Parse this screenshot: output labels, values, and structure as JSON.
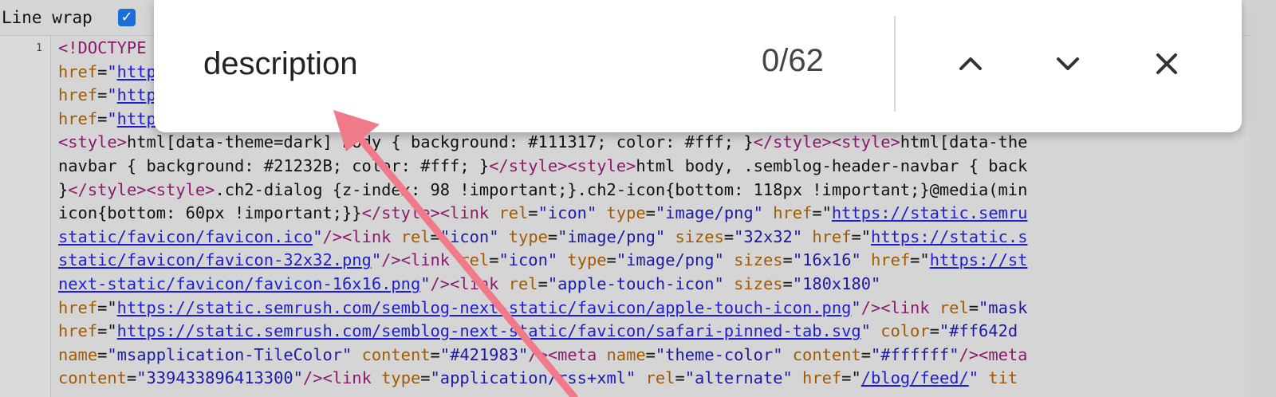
{
  "toolbar": {
    "line_wrap_label": "Line wrap",
    "line_wrap_checked": true
  },
  "gutter": {
    "line_number": "1"
  },
  "find_bar": {
    "query": "description",
    "count": "0/62",
    "prev_icon": "chevron-up-icon",
    "next_icon": "chevron-down-icon",
    "close_icon": "close-icon"
  },
  "colors": {
    "checkbox": "#1a6ed8",
    "annotation_arrow": "#f07a8a",
    "tag": "#8b1a6e",
    "attr": "#a05a00",
    "link": "#1e1ecf"
  },
  "source_lines": [
    [
      [
        "t",
        "<!DOCTYPE html>"
      ]
    ],
    [
      [
        "a",
        "href"
      ],
      [
        "k",
        "="
      ],
      [
        "v",
        "\""
      ],
      [
        "u",
        "https://static.semrush.com/"
      ],
      [
        "v",
        "\""
      ]
    ],
    [
      [
        "a",
        "href"
      ],
      [
        "k",
        "="
      ],
      [
        "v",
        "\""
      ],
      [
        "u",
        "https://static.semrush.com/"
      ],
      [
        "v",
        "\""
      ]
    ],
    [
      [
        "a",
        "href"
      ],
      [
        "k",
        "="
      ],
      [
        "v",
        "\""
      ],
      [
        "u",
        "https://static.semrush.com/"
      ],
      [
        "v",
        "\""
      ]
    ],
    [
      [
        "t",
        "<style>"
      ],
      [
        "k",
        "html[data-theme=dark] body { background: #111317; color: #fff; }"
      ],
      [
        "t",
        "</style><style>"
      ],
      [
        "k",
        "html[data-the"
      ]
    ],
    [
      [
        "k",
        "navbar { background: #21232B; color: #fff; }"
      ],
      [
        "t",
        "</style><style>"
      ],
      [
        "k",
        "html body, .semblog-header-navbar { back"
      ]
    ],
    [
      [
        "k",
        "}"
      ],
      [
        "t",
        "</style><style>"
      ],
      [
        "k",
        ".ch2-dialog {z-index: 98 !important;}.ch2-icon{bottom: 118px !important;}@media(min"
      ]
    ],
    [
      [
        "k",
        "icon{bottom: 60px !important;}}"
      ],
      [
        "t",
        "</style><link "
      ],
      [
        "a",
        "rel"
      ],
      [
        "k",
        "="
      ],
      [
        "v",
        "\"icon\""
      ],
      [
        "a",
        " type"
      ],
      [
        "k",
        "="
      ],
      [
        "v",
        "\"image/png\""
      ],
      [
        "a",
        " href"
      ],
      [
        "k",
        "=\""
      ],
      [
        "u",
        "https://static.semru"
      ]
    ],
    [
      [
        "u",
        "static/favicon/favicon.ico"
      ],
      [
        "v",
        "\""
      ],
      [
        "t",
        "/><link "
      ],
      [
        "a",
        "rel"
      ],
      [
        "k",
        "="
      ],
      [
        "v",
        "\"icon\""
      ],
      [
        "a",
        " type"
      ],
      [
        "k",
        "="
      ],
      [
        "v",
        "\"image/png\""
      ],
      [
        "a",
        " sizes"
      ],
      [
        "k",
        "="
      ],
      [
        "v",
        "\"32x32\""
      ],
      [
        "a",
        " href"
      ],
      [
        "k",
        "=\""
      ],
      [
        "u",
        "https://static.s"
      ]
    ],
    [
      [
        "u",
        "static/favicon/favicon-32x32.png"
      ],
      [
        "v",
        "\""
      ],
      [
        "t",
        "/><link "
      ],
      [
        "a",
        "rel"
      ],
      [
        "k",
        "="
      ],
      [
        "v",
        "\"icon\""
      ],
      [
        "a",
        " type"
      ],
      [
        "k",
        "="
      ],
      [
        "v",
        "\"image/png\""
      ],
      [
        "a",
        " sizes"
      ],
      [
        "k",
        "="
      ],
      [
        "v",
        "\"16x16\""
      ],
      [
        "a",
        " href"
      ],
      [
        "k",
        "=\""
      ],
      [
        "u",
        "https://st"
      ]
    ],
    [
      [
        "u",
        "next-static/favicon/favicon-16x16.png"
      ],
      [
        "v",
        "\""
      ],
      [
        "t",
        "/><link "
      ],
      [
        "a",
        "rel"
      ],
      [
        "k",
        "="
      ],
      [
        "v",
        "\"apple-touch-icon\""
      ],
      [
        "a",
        " sizes"
      ],
      [
        "k",
        "="
      ],
      [
        "v",
        "\"180x180\""
      ]
    ],
    [
      [
        "a",
        "href"
      ],
      [
        "k",
        "=\""
      ],
      [
        "u",
        "https://static.semrush.com/semblog-next-static/favicon/apple-touch-icon.png"
      ],
      [
        "v",
        "\""
      ],
      [
        "t",
        "/><link "
      ],
      [
        "a",
        "rel"
      ],
      [
        "k",
        "="
      ],
      [
        "v",
        "\"mask"
      ]
    ],
    [
      [
        "a",
        "href"
      ],
      [
        "k",
        "=\""
      ],
      [
        "u",
        "https://static.semrush.com/semblog-next-static/favicon/safari-pinned-tab.svg"
      ],
      [
        "v",
        "\""
      ],
      [
        "a",
        " color"
      ],
      [
        "k",
        "="
      ],
      [
        "v",
        "\"#ff642d"
      ]
    ],
    [
      [
        "a",
        "name"
      ],
      [
        "k",
        "="
      ],
      [
        "v",
        "\"msapplication-TileColor\""
      ],
      [
        "a",
        " content"
      ],
      [
        "k",
        "="
      ],
      [
        "v",
        "\"#421983\""
      ],
      [
        "t",
        "/><meta "
      ],
      [
        "a",
        "name"
      ],
      [
        "k",
        "="
      ],
      [
        "v",
        "\"theme-color\""
      ],
      [
        "a",
        " content"
      ],
      [
        "k",
        "="
      ],
      [
        "v",
        "\"#ffffff\""
      ],
      [
        "t",
        "/><meta"
      ]
    ],
    [
      [
        "a",
        "content"
      ],
      [
        "k",
        "="
      ],
      [
        "v",
        "\"339433896413300\""
      ],
      [
        "t",
        "/><link "
      ],
      [
        "a",
        "type"
      ],
      [
        "k",
        "="
      ],
      [
        "v",
        "\"application/rss+xml\""
      ],
      [
        "a",
        " rel"
      ],
      [
        "k",
        "="
      ],
      [
        "v",
        "\"alternate\""
      ],
      [
        "a",
        " href"
      ],
      [
        "k",
        "=\""
      ],
      [
        "u",
        "/blog/feed/"
      ],
      [
        "v",
        "\""
      ],
      [
        "a",
        " tit"
      ]
    ]
  ]
}
